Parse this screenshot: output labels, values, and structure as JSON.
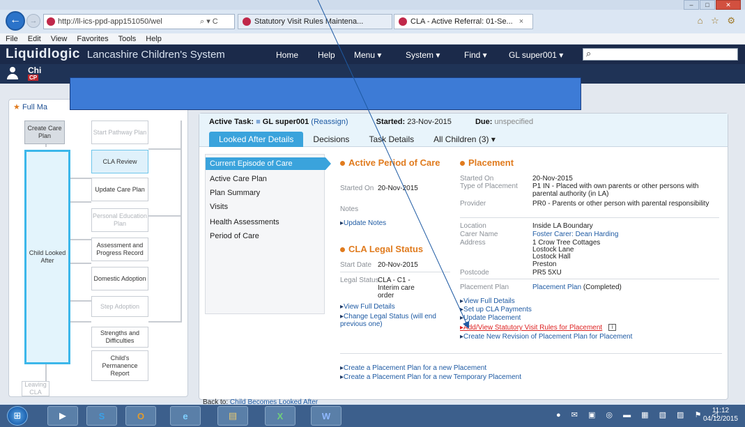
{
  "browser": {
    "address_url": "http://ll-ics-ppd-app151050/wel",
    "address_icons": "⌕ ▾ C",
    "tabs": [
      {
        "label": "Statutory Visit Rules Maintena..."
      },
      {
        "label": "CLA - Active Referral: 01-Se...",
        "close": "×"
      }
    ],
    "toolbar_icons": "⌂ ☆ ⚙",
    "window_controls": [
      "–",
      "□",
      "✕"
    ]
  },
  "menu": {
    "items": [
      "File",
      "Edit",
      "View",
      "Favorites",
      "Tools",
      "Help"
    ]
  },
  "app": {
    "logo": "Liquidlogic",
    "system_name": "Lancashire Children's System",
    "nav": [
      "Home",
      "Help",
      "Menu ▾",
      "System ▾",
      "Find ▾",
      "GL super001 ▾"
    ],
    "search_icon": "⌕",
    "child_name": "Chi",
    "child_badge": "CP"
  },
  "map": {
    "title": "Full Ma",
    "home_icon": "★",
    "nodes": {
      "create_care_plan": "Create Care Plan",
      "start_pathway": "Start Pathway Plan",
      "cla_review": "CLA Review",
      "update_care_plan": "Update Care Plan",
      "pep": "Personal Education Plan",
      "assessment": "Assessment and Progress Record",
      "child_looked_after": "Child Looked After",
      "domestic_adoption": "Domestic Adoption",
      "step_adoption": "Step Adoption",
      "strengths": "Strengths and Difficulties",
      "permanence": "Child's Permanence Report",
      "leaving": "Leaving CLA"
    }
  },
  "task": {
    "active_task_label": "Active Task:",
    "user": "GL super001",
    "reassign": "(Reassign)",
    "started_label": "Started:",
    "started": "23-Nov-2015",
    "due_label": "Due:",
    "due": "unspecified"
  },
  "tabs": [
    {
      "label": "Looked After Details"
    },
    {
      "label": "Decisions"
    },
    {
      "label": "Task Details"
    },
    {
      "label": "All Children (3) ▾"
    }
  ],
  "leftnav": [
    "Current Episode of Care",
    "Active Care Plan",
    "Plan Summary",
    "Visits",
    "Health Assessments",
    "Period of Care"
  ],
  "active_period": {
    "title": "Active Period of Care",
    "started_on_label": "Started On",
    "started_on": "20-Nov-2015",
    "notes_label": "Notes",
    "update_notes": "Update Notes"
  },
  "legal_status": {
    "title": "CLA Legal Status",
    "start_date_label": "Start Date",
    "start_date": "20-Nov-2015",
    "legal_status_label": "Legal Status",
    "legal_status": "CLA - C1 - Interim care order",
    "view_full": "View Full Details",
    "change": "Change Legal Status (will end previous one)"
  },
  "placement": {
    "title": "Placement",
    "started_on_label": "Started On",
    "started_on": "20-Nov-2015",
    "type_label": "Type of Placement",
    "type": "P1 IN - Placed with own parents or other persons with parental authority (in LA)",
    "provider_label": "Provider",
    "provider": "PR0 - Parents or other person with parental responsibility",
    "location_label": "Location",
    "location": "Inside LA Boundary",
    "carer_label": "Carer Name",
    "carer": "Foster Carer: Dean Harding",
    "address_label": "Address",
    "address": [
      "1 Crow Tree Cottages",
      "Lostock Lane",
      "Lostock Hall",
      "Preston"
    ],
    "postcode_label": "Postcode",
    "postcode": "PR5 5XU",
    "plan_label": "Placement Plan",
    "plan_link": "Placement Plan",
    "plan_status": "(Completed)",
    "actions": {
      "view_full": "View Full Details",
      "setup_payments": "Set up CLA Payments",
      "update": "Update Placement",
      "stat_visit": "Add/View Statutory Visit Rules for Placement",
      "new_revision": "Create New Revision of Placement Plan for Placement"
    },
    "info_icon": "i"
  },
  "bottom_actions": {
    "new_plan": "Create a Placement Plan for a new Placement",
    "new_temp_plan": "Create a Placement Plan for a new Temporary Placement"
  },
  "back_to": {
    "label": "Back to:",
    "link": "Child Becomes Looked After"
  },
  "taskbar": {
    "start_icon": "⊞",
    "apps": [
      "▶",
      "S",
      "O",
      "e",
      "▤",
      "X",
      "W"
    ],
    "tray": "● ✉ ▣ ◎ ▬ ▦ ▧ ▨ ⚑ ◁",
    "time": "11:12",
    "date": "04/12/2015"
  }
}
